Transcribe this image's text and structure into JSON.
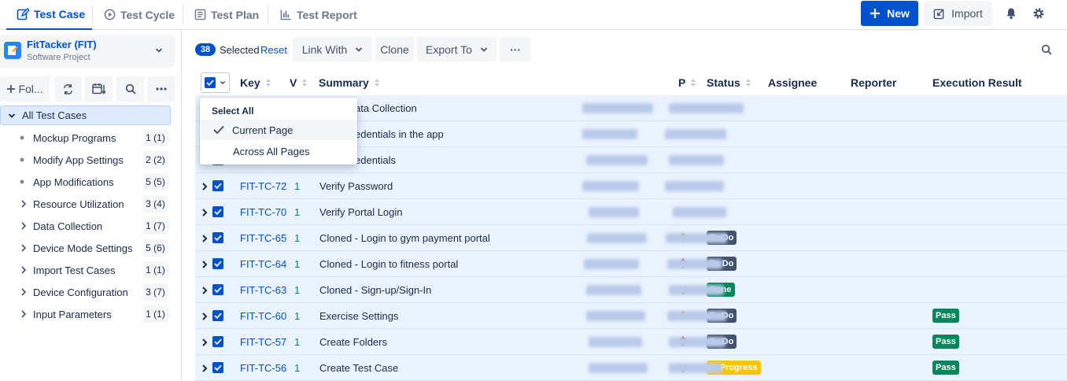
{
  "tabs": [
    {
      "label": "Test Case",
      "icon": "edit-square-icon",
      "active": true
    },
    {
      "label": "Test Cycle",
      "icon": "play-circle-icon",
      "active": false
    },
    {
      "label": "Test Plan",
      "icon": "document-list-icon",
      "active": false
    },
    {
      "label": "Test Report",
      "icon": "bar-chart-icon",
      "active": false
    }
  ],
  "header_actions": {
    "new_label": "New",
    "import_label": "Import"
  },
  "project": {
    "name": "FitTacker (FIT)",
    "type": "Software Project"
  },
  "sidebar": {
    "folder_button_label": "Fol...",
    "all_label": "All Test Cases",
    "folders": [
      {
        "label": "Mockup Programs",
        "count": "1 (1)",
        "expandable": false
      },
      {
        "label": "Modify App Settings",
        "count": "2 (2)",
        "expandable": false
      },
      {
        "label": "App Modifications",
        "count": "5 (5)",
        "expandable": false
      },
      {
        "label": "Resource Utilization",
        "count": "3 (4)",
        "expandable": true
      },
      {
        "label": "Data Collection",
        "count": "1 (7)",
        "expandable": true
      },
      {
        "label": "Device Mode Settings",
        "count": "5 (6)",
        "expandable": true
      },
      {
        "label": "Import Test Cases",
        "count": "1 (1)",
        "expandable": true
      },
      {
        "label": "Device Configuration",
        "count": "3 (7)",
        "expandable": true
      },
      {
        "label": "Input Parameters",
        "count": "1 (1)",
        "expandable": true
      }
    ]
  },
  "toolbar": {
    "selected_count": "38",
    "selected_label": "Selected",
    "reset_label": "Reset",
    "link_with_label": "Link With",
    "clone_label": "Clone",
    "export_label": "Export To",
    "more_label": "···"
  },
  "columns": {
    "key": "Key",
    "version": "V",
    "summary": "Summary",
    "priority": "P",
    "status": "Status",
    "assignee": "Assignee",
    "reporter": "Reporter",
    "execution": "Execution Result"
  },
  "select_menu": {
    "header": "Select All",
    "current_page": "Current Page",
    "across_pages": "Across All Pages"
  },
  "rows": [
    {
      "key": "",
      "version": "",
      "summary": "ata Collection",
      "priority": "",
      "status": "",
      "execution": ""
    },
    {
      "key": "",
      "version": "",
      "summary": "edentials in the app",
      "priority": "",
      "status": "",
      "execution": ""
    },
    {
      "key": "",
      "version": "",
      "summary": "edentials",
      "priority": "",
      "status": "",
      "execution": ""
    },
    {
      "key": "FIT-TC-72",
      "version": "1",
      "summary": "Verify Password",
      "priority": "",
      "status": "",
      "execution": ""
    },
    {
      "key": "FIT-TC-70",
      "version": "1",
      "summary": "Verify Portal Login",
      "priority": "",
      "status": "",
      "execution": ""
    },
    {
      "key": "FIT-TC-65",
      "version": "1",
      "summary": "Cloned - Login to gym payment portal",
      "priority": "medium",
      "status": "To Do",
      "execution": ""
    },
    {
      "key": "FIT-TC-64",
      "version": "1",
      "summary": "Cloned - Login to fitness portal",
      "priority": "high",
      "status": "To Do",
      "execution": ""
    },
    {
      "key": "FIT-TC-63",
      "version": "1",
      "summary": "Cloned - Sign-up/Sign-In",
      "priority": "low",
      "status": "Done",
      "execution": ""
    },
    {
      "key": "FIT-TC-60",
      "version": "1",
      "summary": "Exercise Settings",
      "priority": "medium",
      "status": "To Do",
      "execution": "Pass"
    },
    {
      "key": "FIT-TC-57",
      "version": "1",
      "summary": "Create Folders",
      "priority": "high",
      "status": "To Do",
      "execution": "Pass"
    },
    {
      "key": "FIT-TC-56",
      "version": "1",
      "summary": "Create Test Case",
      "priority": "low",
      "status": "In Progress",
      "execution": "Pass"
    }
  ],
  "colors": {
    "accent": "#0052cc",
    "todo": "#42526e",
    "done": "#00875a",
    "in_progress": "#ffc400",
    "pass": "#00875a",
    "priority_medium": "#ff8b00",
    "priority_high": "#de350b",
    "priority_low": "#36b37e",
    "version": "#00875a"
  }
}
